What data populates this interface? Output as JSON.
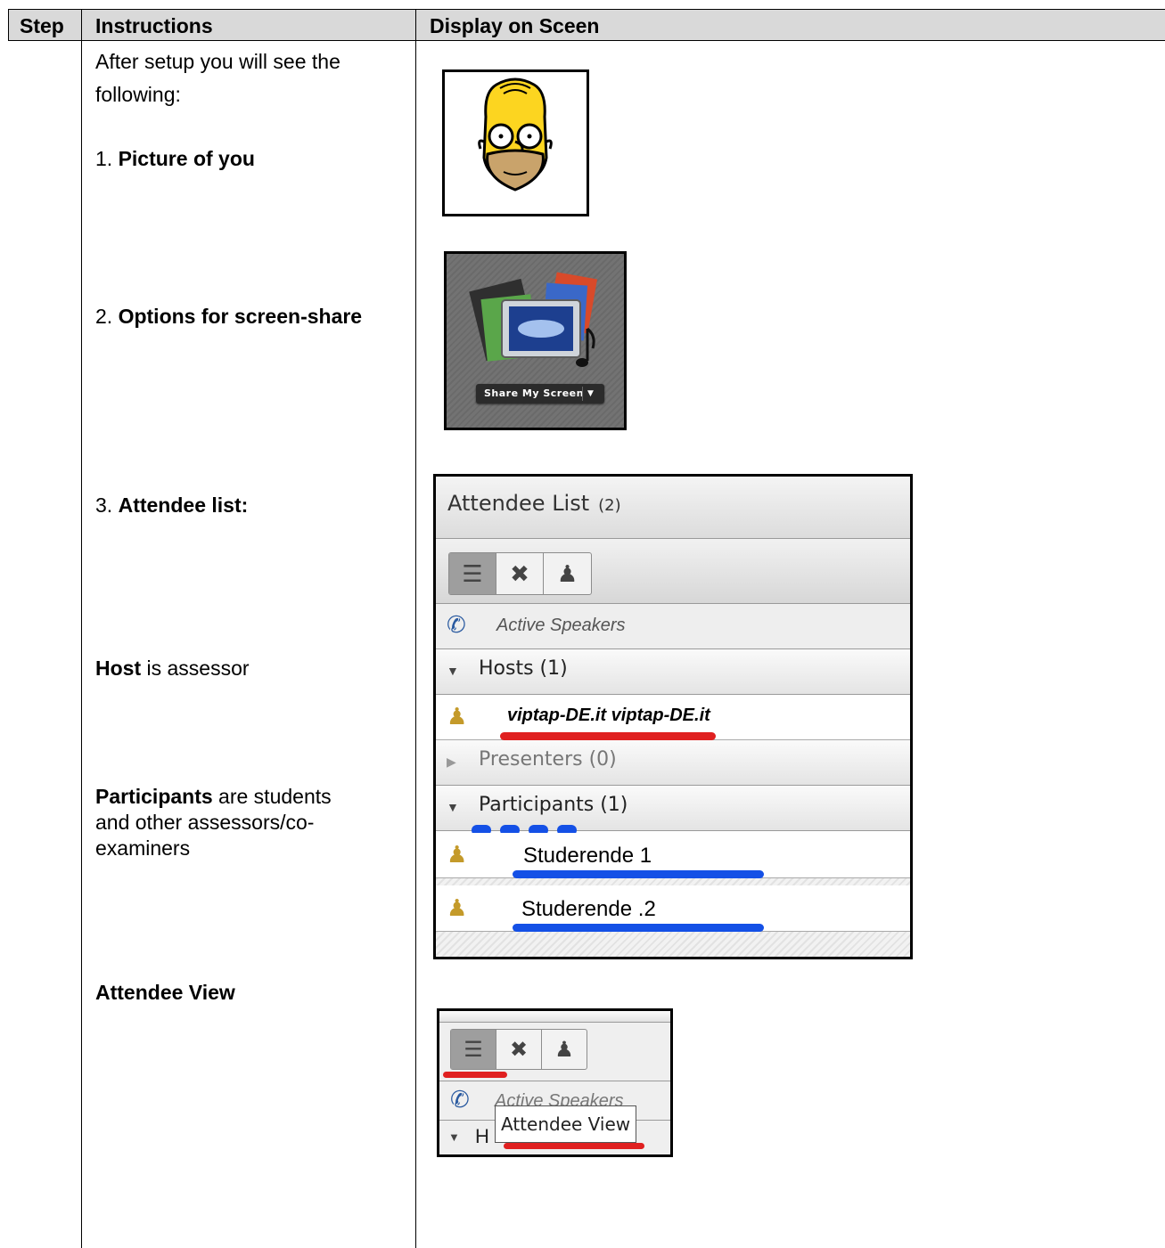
{
  "table": {
    "headers": {
      "step": "Step",
      "instructions": "Instructions",
      "display": "Display on Sceen"
    },
    "intro": [
      "After setup you will see the",
      "following:"
    ],
    "items": [
      {
        "num": "1. ",
        "label": "Picture of you"
      },
      {
        "num": "2. ",
        "label": "Options for screen-share"
      },
      {
        "num": "3. ",
        "label": "Attendee list:"
      }
    ],
    "host_note": {
      "bold": "Host",
      "rest": " is assessor"
    },
    "participants_note": {
      "bold": "Participants",
      "line1": " are students",
      "line2": "and other assessors/co-",
      "line3": "examiners"
    },
    "attendee_view_heading": "Attendee View"
  },
  "share_screen": {
    "button_label": "Share My Screen"
  },
  "attendee_list": {
    "title": "Attendee List",
    "count": "(2)",
    "active_speakers": "Active Speakers",
    "hosts_header": "Hosts (1)",
    "host_name": "viptap-DE.it viptap-DE.it",
    "presenters_header": "Presenters (0)",
    "participants_header": "Participants (1)",
    "participants": [
      "Studerende 1",
      "Studerende .2"
    ]
  },
  "attendee_view_shot": {
    "active_speakers": "Active Speakers",
    "tooltip": "Attendee View",
    "partial_label": "H"
  },
  "colors": {
    "header_bg": "#d9d9d9",
    "red_underline": "#e02020",
    "blue_underline": "#1450e6"
  }
}
